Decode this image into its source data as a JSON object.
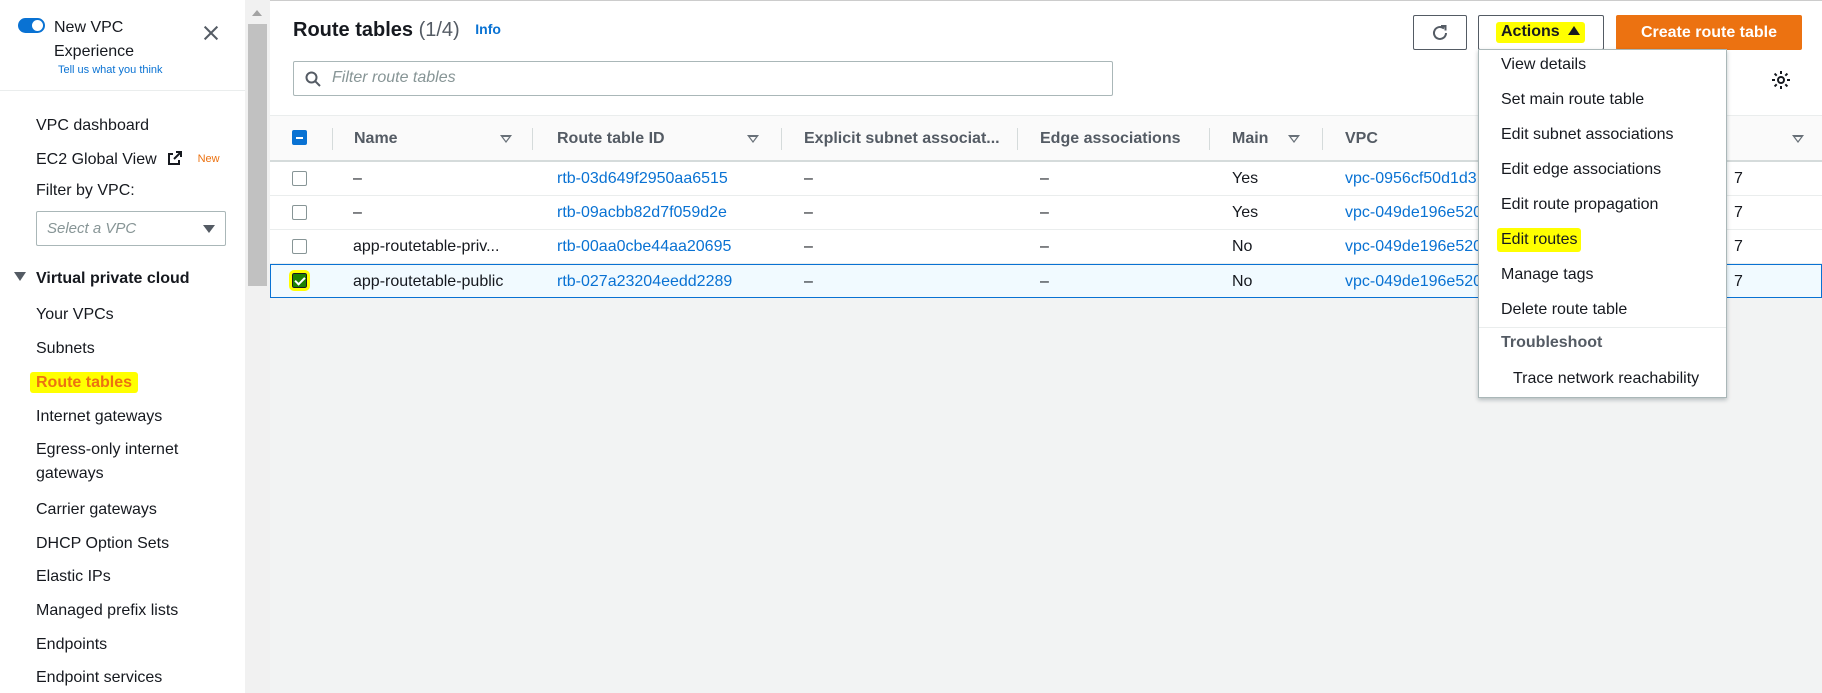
{
  "sidebar": {
    "experience_toggle_label": "New VPC Experience",
    "feedback_link": "Tell us what you think",
    "nav": [
      {
        "label": "VPC dashboard"
      },
      {
        "label": "EC2 Global View",
        "badge": "New"
      }
    ],
    "filter_label": "Filter by VPC:",
    "vpc_select_placeholder": "Select a VPC",
    "section_title": "Virtual private cloud",
    "section_items": [
      {
        "label": "Your VPCs"
      },
      {
        "label": "Subnets"
      },
      {
        "label": "Route tables"
      },
      {
        "label": "Internet gateways"
      },
      {
        "label": "Egress-only internet"
      },
      {
        "label": "gateways"
      },
      {
        "label": "Carrier gateways"
      },
      {
        "label": "DHCP Option Sets"
      },
      {
        "label": "Elastic IPs"
      },
      {
        "label": "Managed prefix lists"
      },
      {
        "label": "Endpoints"
      },
      {
        "label": "Endpoint services"
      }
    ]
  },
  "header": {
    "title": "Route tables",
    "count": "(1/4)",
    "info": "Info",
    "filter_placeholder": "Filter route tables",
    "actions_label": "Actions",
    "create_label": "Create route table"
  },
  "table": {
    "columns": [
      "Name",
      "Route table ID",
      "Explicit subnet associat...",
      "Edge associations",
      "Main",
      "VPC"
    ],
    "rows": [
      {
        "name": "–",
        "id": "rtb-03d649f2950aa6515",
        "subnet": "–",
        "edge": "–",
        "main": "Yes",
        "vpc": "vpc-0956cf50d1d3",
        "owner_tail": "7",
        "selected": false
      },
      {
        "name": "–",
        "id": "rtb-09acbb82d7f059d2e",
        "subnet": "–",
        "edge": "–",
        "main": "Yes",
        "vpc": "vpc-049de196e520",
        "owner_tail": "7",
        "selected": false
      },
      {
        "name": "app-routetable-priv...",
        "id": "rtb-00aa0cbe44aa20695",
        "subnet": "–",
        "edge": "–",
        "main": "No",
        "vpc": "vpc-049de196e520",
        "owner_tail": "7",
        "selected": false
      },
      {
        "name": "app-routetable-public",
        "id": "rtb-027a23204eedd2289",
        "subnet": "–",
        "edge": "–",
        "main": "No",
        "vpc": "vpc-049de196e520",
        "owner_tail": "7",
        "selected": true
      }
    ]
  },
  "actions_menu": {
    "items": [
      "View details",
      "Set main route table",
      "Edit subnet associations",
      "Edit edge associations",
      "Edit route propagation",
      "Edit routes",
      "Manage tags",
      "Delete route table"
    ],
    "group_label": "Troubleshoot",
    "group_items": [
      "Trace network reachability"
    ]
  },
  "colors": {
    "primary_orange": "#ec7211",
    "link_blue": "#0972d3",
    "highlight_yellow": "#ffff00"
  }
}
